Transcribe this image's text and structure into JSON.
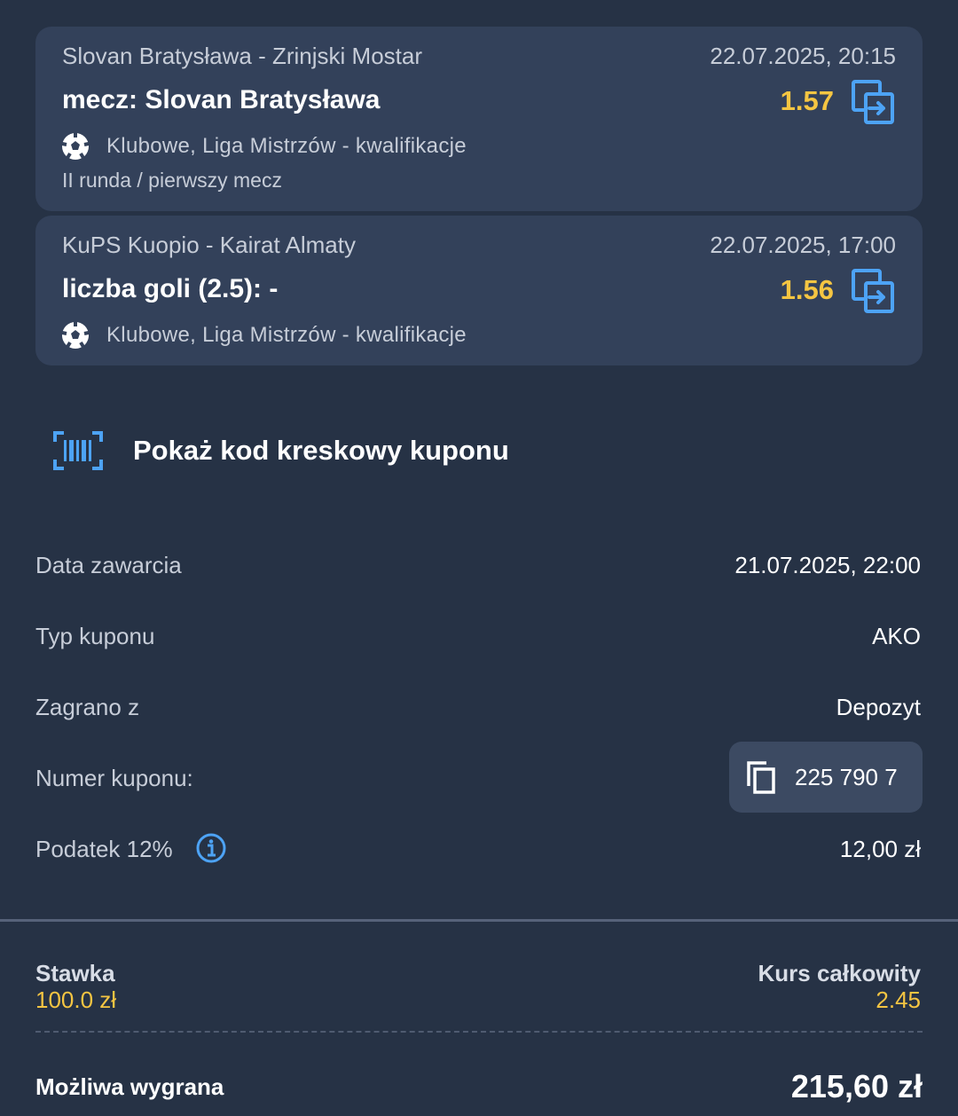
{
  "bets": [
    {
      "match": "Slovan Bratysława - Zrinjski Mostar",
      "date": "22.07.2025, 20:15",
      "type": "mecz: Slovan Bratysława",
      "odds": "1.57",
      "league": "Klubowe, Liga Mistrzów - kwalifikacje",
      "round": "II runda / pierwszy mecz",
      "sport_icon": "soccer-ball-icon",
      "action_icon": "copy-arrow-icon"
    },
    {
      "match": "KuPS Kuopio - Kairat Almaty",
      "date": "22.07.2025, 17:00",
      "type": "liczba goli (2.5): -",
      "odds": "1.56",
      "league": "Klubowe, Liga Mistrzów - kwalifikacje",
      "sport_icon": "soccer-ball-icon",
      "action_icon": "copy-arrow-icon"
    }
  ],
  "barcode": {
    "label": "Pokaż kod kreskowy kuponu",
    "icon": "barcode-scan-icon"
  },
  "details": {
    "date_label": "Data zawarcia",
    "date_value": "21.07.2025, 22:00",
    "type_label": "Typ kuponu",
    "type_value": "AKO",
    "source_label": "Zagrano z",
    "source_value": "Depozyt",
    "number_label": "Numer kuponu:",
    "number_value": "225 790 7",
    "tax_label": "Podatek 12%",
    "tax_value": "12,00 zł"
  },
  "summary": {
    "stake_label": "Stawka",
    "stake_value": "100.0 zł",
    "total_odds_label": "Kurs całkowity",
    "total_odds_value": "2.45",
    "win_label": "Możliwa wygrana",
    "win_value": "215,60 zł"
  },
  "colors": {
    "background": "#263245",
    "card": "#33415a",
    "accent_odds": "#f5c542",
    "accent_icon": "#4da3f5"
  }
}
